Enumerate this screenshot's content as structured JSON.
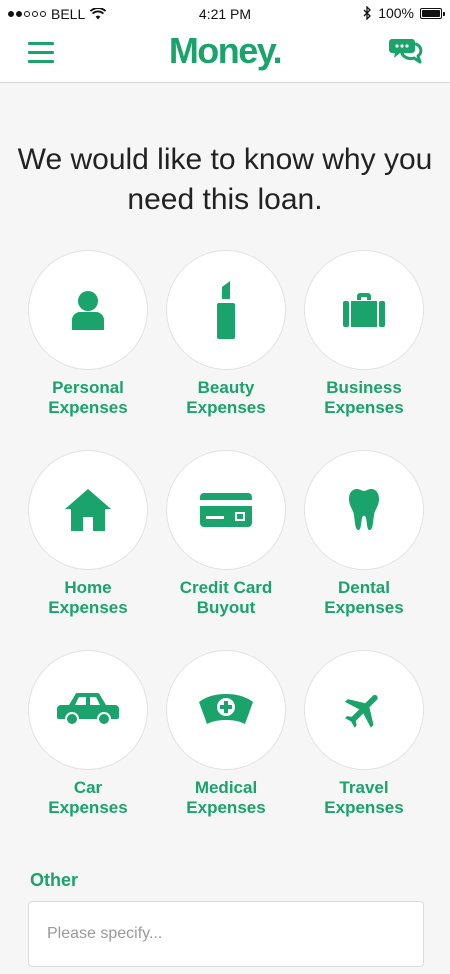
{
  "status_bar": {
    "carrier": "BELL",
    "time": "4:21 PM",
    "battery": "100%",
    "battery_level": 1.0,
    "signal_bars_filled": 2,
    "signal_bars_total": 5
  },
  "header": {
    "logo": "Money",
    "logo_dot": "."
  },
  "question": "We would like to know why you need this loan.",
  "categories": [
    {
      "line1": "Personal",
      "line2": "Expenses",
      "icon": "person-icon"
    },
    {
      "line1": "Beauty",
      "line2": "Expenses",
      "icon": "lipstick-icon"
    },
    {
      "line1": "Business",
      "line2": "Expenses",
      "icon": "briefcase-icon"
    },
    {
      "line1": "Home",
      "line2": "Expenses",
      "icon": "house-icon"
    },
    {
      "line1": "Credit Card",
      "line2": "Buyout",
      "icon": "credit-card-icon"
    },
    {
      "line1": "Dental",
      "line2": "Expenses",
      "icon": "tooth-icon"
    },
    {
      "line1": "Car",
      "line2": "Expenses",
      "icon": "car-icon"
    },
    {
      "line1": "Medical",
      "line2": "Expenses",
      "icon": "nurse-cap-icon"
    },
    {
      "line1": "Travel",
      "line2": "Expenses",
      "icon": "airplane-icon"
    }
  ],
  "other": {
    "label": "Other",
    "placeholder": "Please specify...",
    "value": ""
  },
  "colors": {
    "accent": "#1aa36b",
    "background": "#f6f6f6",
    "text": "#222222"
  }
}
